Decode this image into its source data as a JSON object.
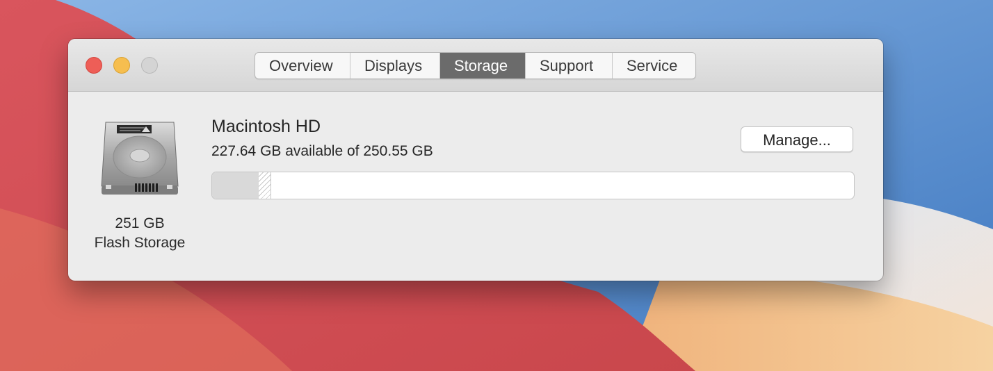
{
  "window": {
    "tabs": [
      {
        "label": "Overview"
      },
      {
        "label": "Displays"
      },
      {
        "label": "Storage"
      },
      {
        "label": "Support"
      },
      {
        "label": "Service"
      }
    ],
    "selected_tab": "Storage"
  },
  "drive": {
    "icon": "hard-drive-icon",
    "size": "251 GB",
    "type": "Flash Storage"
  },
  "volume": {
    "name": "Macintosh HD",
    "availability": "227.64 GB available of 250.55 GB",
    "manage_label": "Manage...",
    "usage": {
      "used_fraction": 0.073,
      "purgeable_fraction": 0.018
    }
  },
  "colors": {
    "close": "#ee5e57",
    "minimize": "#f6be4f",
    "zoom": "#d4d4d4",
    "selected_tab": "#6b6b6b"
  }
}
